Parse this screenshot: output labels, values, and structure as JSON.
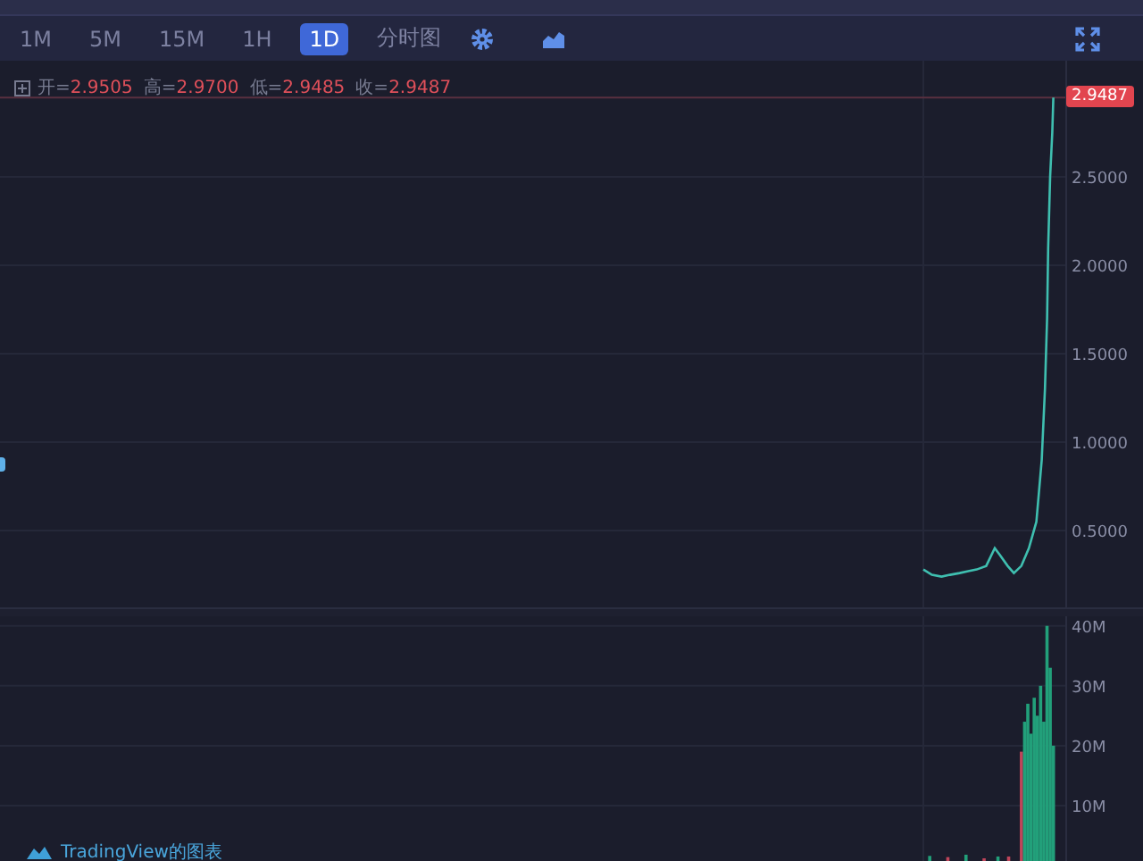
{
  "toolbar": {
    "intervals": [
      {
        "label": "1M",
        "selected": false
      },
      {
        "label": "5M",
        "selected": false
      },
      {
        "label": "15M",
        "selected": false
      },
      {
        "label": "1H",
        "selected": false
      },
      {
        "label": "1D",
        "selected": true
      }
    ],
    "chart_type_button": "分时图"
  },
  "legend": [
    {
      "label": "开=",
      "value": "2.9505"
    },
    {
      "label": "高=",
      "value": "2.9700"
    },
    {
      "label": "低=",
      "value": "2.9485"
    },
    {
      "label": "收=",
      "value": "2.9487"
    }
  ],
  "price_pane": {
    "last_price_label": "2.9487",
    "axis_labels": [
      "2.5000",
      "2.0000",
      "1.5000",
      "1.0000",
      "0.5000"
    ]
  },
  "volume_pane": {
    "axis_labels": [
      "40M",
      "30M",
      "20M",
      "10M"
    ]
  },
  "attribution": "TradingView的图表"
}
